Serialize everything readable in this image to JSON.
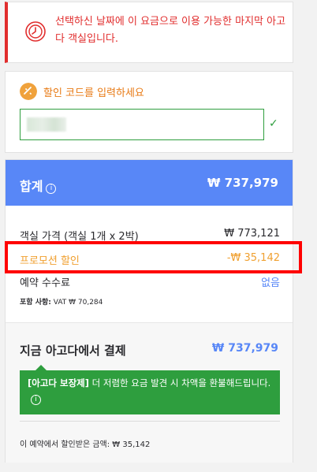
{
  "alert": {
    "icon": "clock-alert-icon",
    "text": "선택하신 날짜에 이 요금으로 이용 가능한 마지막 아고다 객실입니다.",
    "color": "#e12d2d"
  },
  "promo": {
    "icon": "coupon-icon",
    "label": "할인 코드를 입력하세요",
    "input_value": "",
    "check_icon": "checkmark-icon",
    "check_glyph": "✓"
  },
  "summary": {
    "total_label": "합계",
    "info_glyph": "i",
    "total_value": "₩ 737,979",
    "rows": [
      {
        "label": "객실 가격 (객실 1개 x 2박)",
        "value": "₩ 773,121"
      },
      {
        "label": "프로모션 할인",
        "value": "-₩ 35,142"
      },
      {
        "label": "예약 수수료",
        "value": "없음"
      }
    ],
    "vat_label": "포함 사항:",
    "vat_value": "VAT ₩ 70,284",
    "pay_label": "지금 아고다에서 결제",
    "pay_value": "₩ 737,979",
    "guarantee_bold": "[아고다 보장제]",
    "guarantee_text": "더 저렴한 요금 발견 시 차액을 환불해드립니다.",
    "saved_text": "이 예약에서 할인받은 금액: ₩ 35,142"
  },
  "colors": {
    "accent_blue": "#5887f7",
    "promo_orange": "#f0a030",
    "green": "#2e9e3e",
    "highlight_red": "#ff0000"
  }
}
